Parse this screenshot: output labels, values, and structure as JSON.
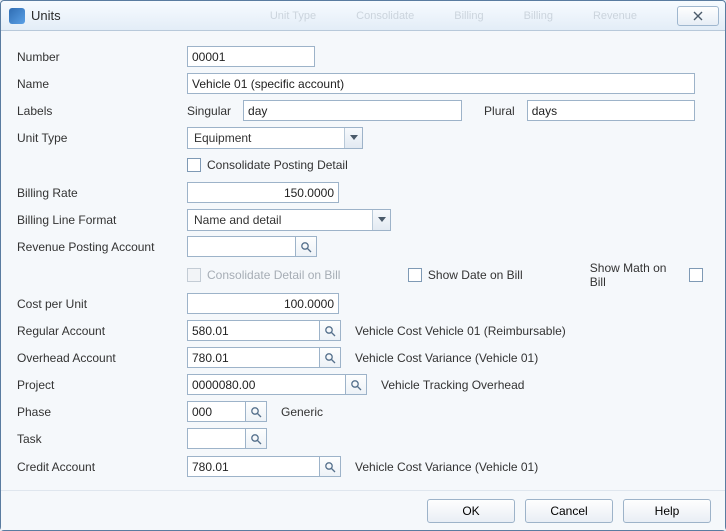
{
  "window": {
    "title": "Units"
  },
  "ghosts": [
    "Unit Type",
    "Consolidate",
    "Billing",
    "Billing",
    "Revenue"
  ],
  "labels": {
    "number": "Number",
    "name": "Name",
    "labels": "Labels",
    "singular": "Singular",
    "plural": "Plural",
    "unitType": "Unit Type",
    "consolidatePosting": "Consolidate Posting Detail",
    "billingRate": "Billing Rate",
    "billingLineFormat": "Billing Line Format",
    "revenuePosting": "Revenue Posting Account",
    "consolidateDetailOnBill": "Consolidate Detail on Bill",
    "showDateOnBill": "Show Date on Bill",
    "showMathOnBill": "Show Math on Bill",
    "costPerUnit": "Cost per Unit",
    "regularAccount": "Regular Account",
    "overheadAccount": "Overhead Account",
    "project": "Project",
    "phase": "Phase",
    "task": "Task",
    "creditAccount": "Credit Account"
  },
  "fields": {
    "number": "00001",
    "name": "Vehicle 01 (specific account)",
    "singular": "day",
    "plural": "days",
    "unitType": "Equipment",
    "billingRate": "150.0000",
    "billingLineFormat": "Name and detail",
    "revenuePosting": "",
    "costPerUnit": "100.0000",
    "regularAccount": "580.01",
    "regularAccountDesc": "Vehicle Cost Vehicle 01 (Reimbursable)",
    "overheadAccount": "780.01",
    "overheadAccountDesc": "Vehicle Cost Variance (Vehicle 01)",
    "project": "0000080.00",
    "projectDesc": "Vehicle Tracking Overhead",
    "phase": "000",
    "phaseDesc": "Generic",
    "task": "",
    "creditAccount": "780.01",
    "creditAccountDesc": "Vehicle Cost Variance (Vehicle 01)"
  },
  "buttons": {
    "ok": "OK",
    "cancel": "Cancel",
    "help": "Help"
  }
}
